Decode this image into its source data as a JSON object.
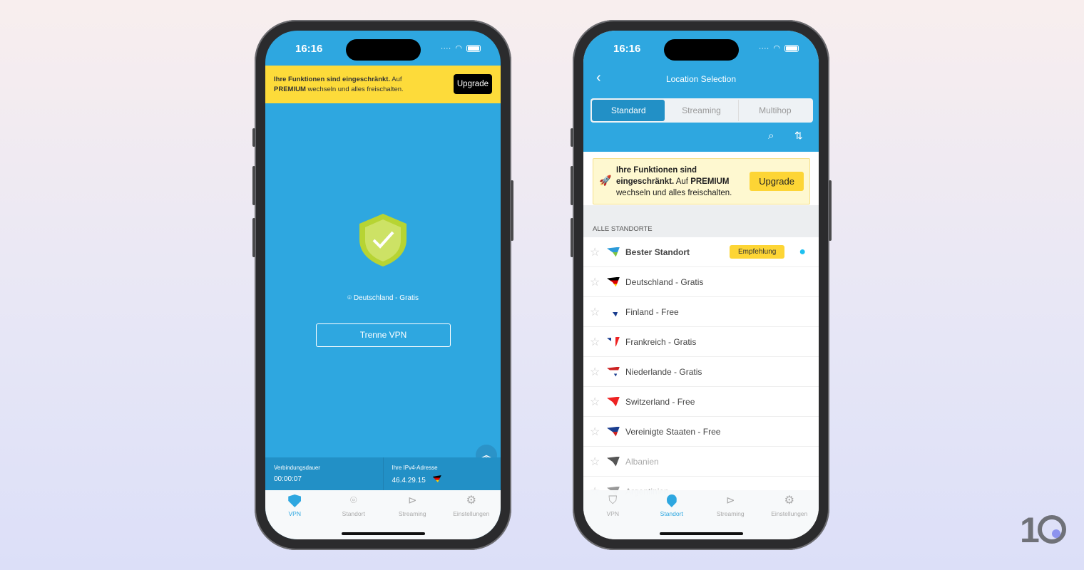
{
  "left": {
    "time": "16:16",
    "banner": {
      "bold": "Ihre Funktionen sind eingeschränkt.",
      "text1": " Auf ",
      "bold2": "PREMIUM",
      "text2": " wechseln und alles freischalten.",
      "upgrade": "Upgrade"
    },
    "location": "Deutschland - Gratis",
    "disconnect": "Trenne VPN",
    "info": {
      "duration_label": "Verbindungsdauer",
      "duration": "00:00:07",
      "ip_label": "Ihre IPv4-Adresse",
      "ip": "46.4.29.15"
    },
    "tabs": [
      "VPN",
      "Standort",
      "Streaming",
      "Einstellungen"
    ],
    "active_tab": 0
  },
  "right": {
    "time": "16:16",
    "title": "Location Selection",
    "segments": [
      "Standard",
      "Streaming",
      "Multihop"
    ],
    "active_segment": 0,
    "banner": {
      "bold": "Ihre Funktionen sind eingeschränkt.",
      "text1": " Auf ",
      "bold2": "PREMIUM",
      "text2": " wechseln und alles freischalten.",
      "upgrade": "Upgrade"
    },
    "section": "ALLE STANDORTE",
    "badge": "Empfehlung",
    "locations": [
      {
        "name": "Bester Standort",
        "colors": [
          "#2c9ad8",
          "#7cc243"
        ]
      },
      {
        "name": "Deutschland - Gratis",
        "colors": [
          "#000",
          "#d00",
          "#fc0"
        ]
      },
      {
        "name": "Finland - Free",
        "colors": [
          "#fff",
          "#1a3d8f"
        ]
      },
      {
        "name": "Frankreich - Gratis",
        "colors": [
          "#1a3d8f",
          "#fff",
          "#e22"
        ]
      },
      {
        "name": "Niederlande - Gratis",
        "colors": [
          "#c22",
          "#fff",
          "#1a3d8f"
        ]
      },
      {
        "name": "Switzerland - Free",
        "colors": [
          "#e22"
        ]
      },
      {
        "name": "Vereinigte Staaten - Free",
        "colors": [
          "#1a3d8f",
          "#c22"
        ]
      },
      {
        "name": "Albanien",
        "colors": [
          "#555"
        ]
      },
      {
        "name": "Argentinien",
        "colors": [
          "#999"
        ]
      }
    ],
    "tabs": [
      "VPN",
      "Standort",
      "Streaming",
      "Einstellungen"
    ],
    "active_tab": 1
  },
  "logo": "10",
  "colors": {
    "accent": "#2ea7e0",
    "banner": "#fddb3a"
  }
}
